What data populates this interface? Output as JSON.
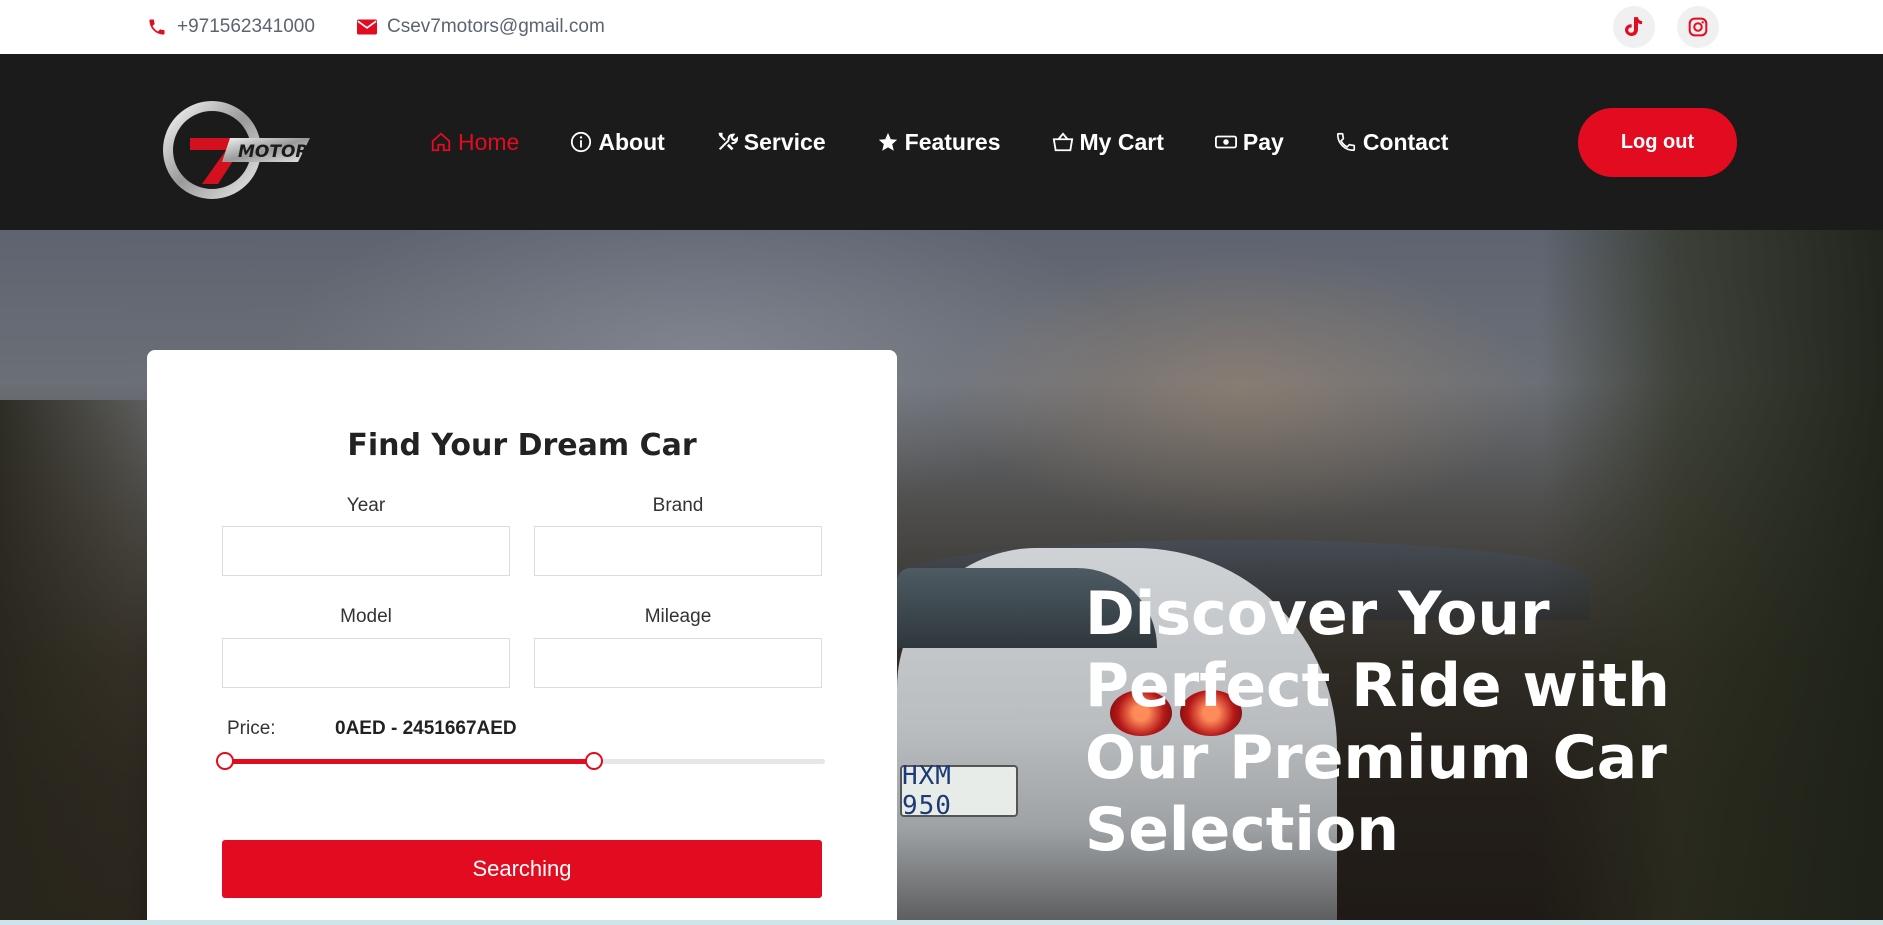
{
  "topbar": {
    "phone": "+971562341000",
    "email": "Csev7motors@gmail.com",
    "phone_icon": "phone-icon",
    "email_icon": "envelope-icon",
    "social": [
      "tiktok-icon",
      "instagram-icon"
    ]
  },
  "nav": {
    "logo_text": "MOTORS",
    "items": [
      {
        "label": "Home",
        "icon": "home-icon",
        "active": true
      },
      {
        "label": "About",
        "icon": "info-icon",
        "active": false
      },
      {
        "label": "Service",
        "icon": "tools-icon",
        "active": false
      },
      {
        "label": "Features",
        "icon": "star-icon",
        "active": false
      },
      {
        "label": "My Cart",
        "icon": "basket-icon",
        "active": false
      },
      {
        "label": "Pay",
        "icon": "cash-icon",
        "active": false
      },
      {
        "label": "Contact",
        "icon": "phone-icon",
        "active": false
      }
    ],
    "logout_label": "Log out"
  },
  "hero": {
    "title": "Discover Your Perfect Ride with Our Premium Car Selection",
    "plate_text": "HXM 950"
  },
  "search": {
    "title": "Find Your Dream Car",
    "year_label": "Year",
    "brand_label": "Brand",
    "model_label": "Model",
    "mileage_label": "Mileage",
    "year_value": "",
    "brand_value": "",
    "model_value": "",
    "mileage_value": "",
    "price_label": "Price:",
    "price_range": "0AED - 2451667AED",
    "slider_min_fraction": 0.0,
    "slider_max_fraction": 0.615,
    "button_label": "Searching"
  },
  "colors": {
    "accent": "#e30b1f",
    "nav_bg": "#1b1b1b"
  }
}
